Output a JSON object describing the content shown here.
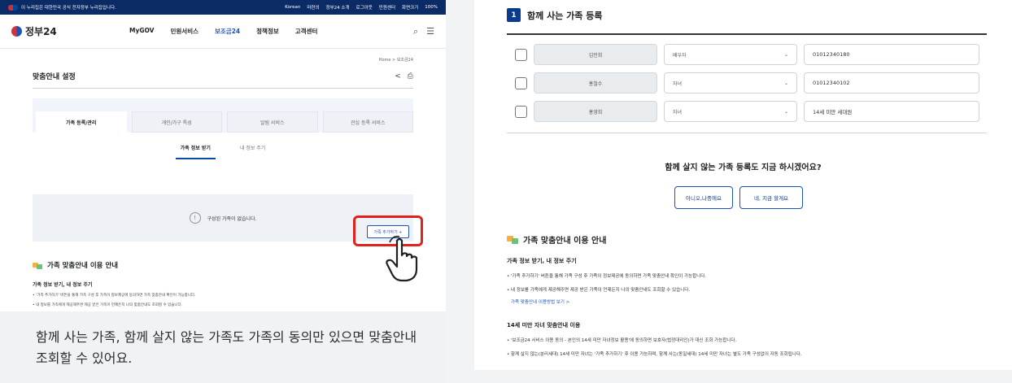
{
  "left": {
    "govbar": {
      "notice": "이 누리집은 대한민국 공식 전자정부 누리집입니다.",
      "lang": "Korean",
      "links": [
        "마련의",
        "정부24 소개",
        "로그아웃",
        "민원센터",
        "화면크기",
        "100%"
      ]
    },
    "nav": {
      "logo": "정부24",
      "menu": [
        "MyGOV",
        "민원서비스",
        "보조금24",
        "정책정보",
        "고객센터"
      ]
    },
    "breadcrumb": "Home > 보조금24",
    "page_title": "맞춤안내 설정",
    "tabs": [
      "가족 등록/관리",
      "개인/가구 특성",
      "알림 서비스",
      "관심 등록 서비스"
    ],
    "subtabs": [
      "가족 정보 받기",
      "내 정보 주기"
    ],
    "empty_msg": "구성된 가족이 없습니다.",
    "add_button": "가족 추가하기 +",
    "guide": {
      "title": "가족 맞춤안내 이용 안내",
      "subtitle": "가족 정보 받기, 내 정보 주기",
      "lines": [
        "• '가족 추가하기' 버튼을 통해 가족 구성 후 가족이 정보제공에 동의하면 가족 맞춤안내 확인이 가능합니다.",
        "• 내 정보를 가족에게 제공해주면 제공 받은 가족이 언제든지 나의 맞춤안내도 조회할 수 있습니다."
      ]
    },
    "caption": "함께 사는 가족, 함께 살지 않는 가족도 가족의 동의만 있으면 맞춤안내 조회할 수 있어요."
  },
  "right": {
    "step_number": "1",
    "step_title": "함께 사는 가족 등록",
    "rows": [
      {
        "name": "김민희",
        "relation": "배우자",
        "phone": "01012340180"
      },
      {
        "name": "홍철수",
        "relation": "자녀",
        "phone": "01012340102"
      },
      {
        "name": "홍영희",
        "relation": "자녀",
        "phone": "14세 미만 세대원"
      }
    ],
    "question": "함께 살지 않는 가족 등록도 지금 하시겠어요?",
    "btn_no": "아니오,나중에요",
    "btn_yes": "네, 지금 할게요",
    "guide": {
      "title": "가족 맞춤안내 이용 안내",
      "subtitle": "가족 정보 받기, 내 정보 주기",
      "lines": [
        "• '가족 추가하기' 버튼을 통해 가족 구성 후 가족이 정보제공에 동의하면 가족 맞춤안내 확인이 가능합니다.",
        "• 내 정보를 가족에게 제공해주면 제공 받은 가족이 언제든지 나의 맞춤안내도 조회할 수 있습니다."
      ],
      "link": "가족 맞춤안내 이용방법 보기 >",
      "subtitle2": "14세 미만 자녀 맞춤안내 이용",
      "lines2": [
        "• '보조금24 서비스 이용 동의 - 본인의 14세 미만 자녀정보 활용'에 동의하면 보호자(법정대리인)가 대신 조회 가능합니다.",
        "• 함께 살지 않는(분리세대) 14세 미만 자녀는 '가족 추가하기' 후 이용 가능하며, 함께 사는(동일세대) 14세 미만 자녀는 별도 가족 구성없이 자동 조회됩니다."
      ]
    }
  },
  "colors": {
    "primary": "#0b3b8c",
    "accent": "#1c54b5",
    "highlight": "#e0221e"
  }
}
